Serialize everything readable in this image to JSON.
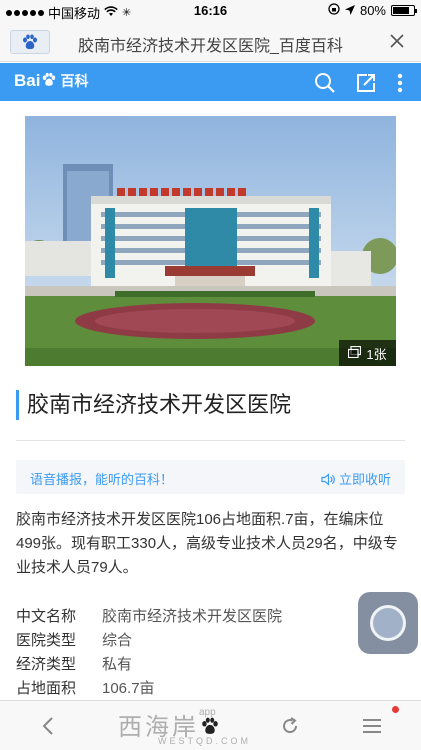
{
  "status": {
    "carrier": "中国移动",
    "time": "16:16",
    "battery": "80%",
    "battery_level": 0.8
  },
  "browser": {
    "page_title": "胶南市经济技术开发区医院_百度百科",
    "close_icon": "close-icon"
  },
  "header": {
    "logo_text_a": "Bai",
    "logo_text_b": "百科",
    "search_icon": "search-icon",
    "share_icon": "share-icon",
    "menu_icon": "menu-icon"
  },
  "hero": {
    "image_count": "1张"
  },
  "entry": {
    "title": "胶南市经济技术开发区医院"
  },
  "audio": {
    "promo": "语音播报，能听的百科！",
    "listen": "立即收听"
  },
  "summary": "胶南市经济技术开发区医院106占地面积.7亩，在编床位499张。现有职工330人，高级专业技术人员29名，中级专业技术人员79人。",
  "info": [
    {
      "key": "中文名称",
      "value": "胶南市经济技术开发区医院"
    },
    {
      "key": "医院类型",
      "value": "综合"
    },
    {
      "key": "经济类型",
      "value": "私有"
    },
    {
      "key": "占地面积",
      "value": "106.7亩"
    }
  ],
  "toolbar": {
    "watermark": "西海岸",
    "watermark_sup": "app",
    "watermark_url": "WESTQD.COM"
  },
  "colors": {
    "accent": "#3b9bf2"
  }
}
